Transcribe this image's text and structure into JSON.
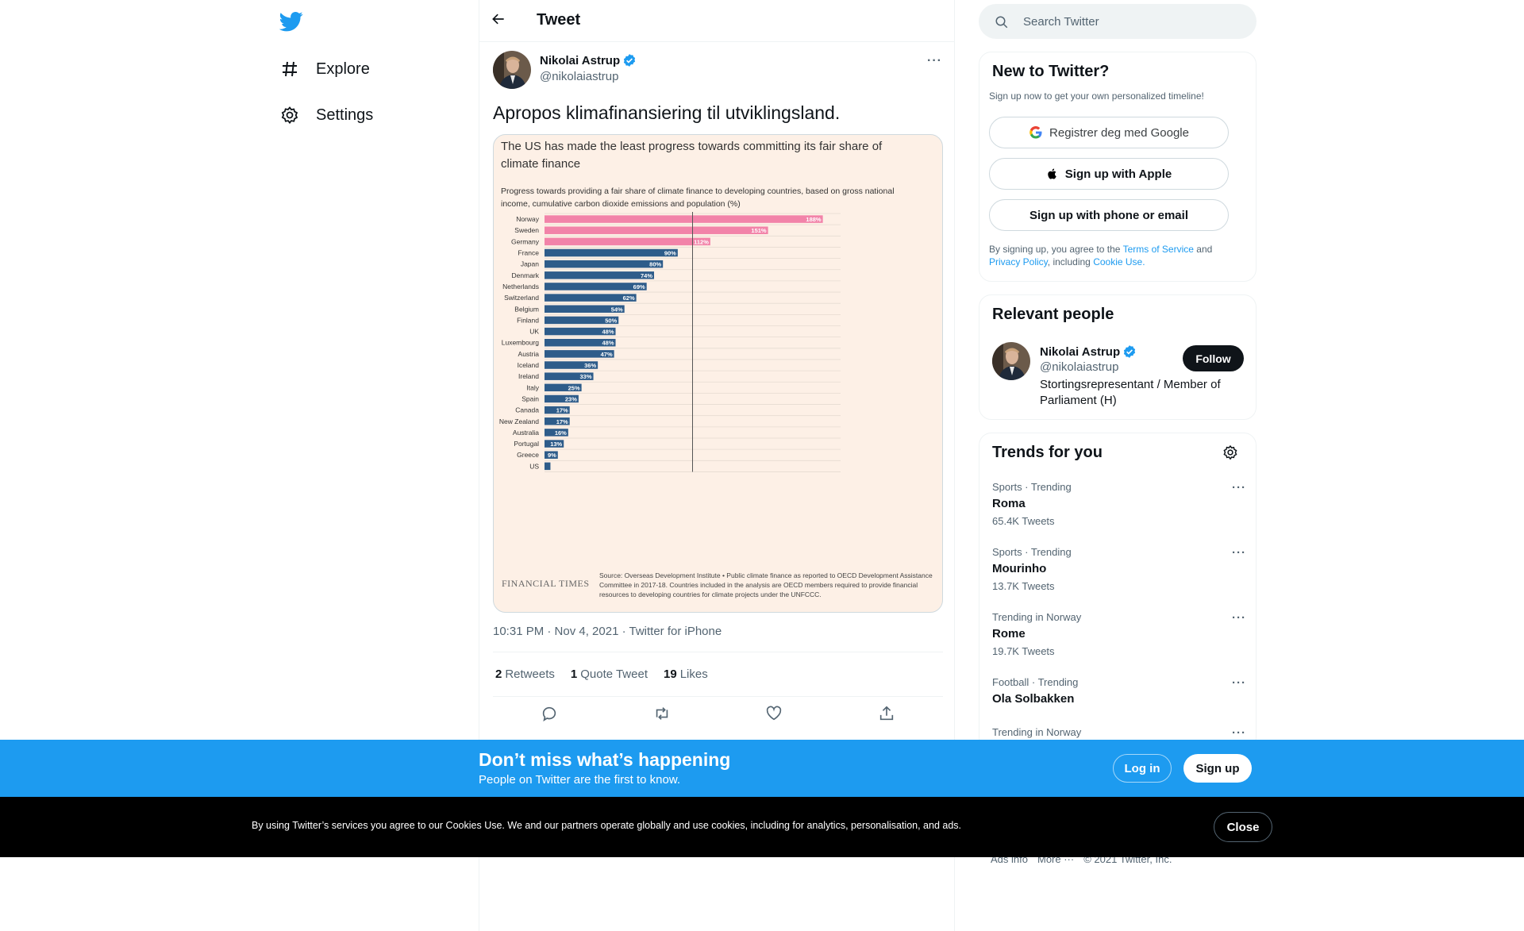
{
  "nav": {
    "items": [
      {
        "label": "Explore",
        "icon": "hashtag-icon"
      },
      {
        "label": "Settings",
        "icon": "gear-icon"
      }
    ]
  },
  "header": {
    "title": "Tweet"
  },
  "tweet": {
    "author_name": "Nikolai Astrup",
    "author_handle": "@nikolaiastrup",
    "text": "Apropos klimafinansiering til utviklingsland.",
    "meta": "10:31 PM · Nov 4, 2021 · Twitter for iPhone",
    "stats": [
      {
        "count": "2",
        "label": "Retweets"
      },
      {
        "count": "1",
        "label": "Quote Tweet"
      },
      {
        "count": "19",
        "label": "Likes"
      }
    ]
  },
  "media": {
    "title": "The US has made the least progress towards committing its fair share of climate finance",
    "subtitle": "Progress towards providing a fair share of climate finance to developing countries, based on gross national income, cumulative carbon dioxide emissions and population (%)",
    "brand": "FINANCIAL TIMES",
    "source": "Source: Overseas Development Institute • Public climate finance as reported to OECD Development Assistance Committee in 2017-18. Countries included in the analysis are OECD members required to provide financial resources to developing countries for climate projects under the UNFCCC."
  },
  "chart_data": {
    "type": "bar",
    "orientation": "horizontal",
    "title": "The US has made the least progress towards committing its fair share of climate finance",
    "subtitle": "Progress towards providing a fair share of climate finance to developing countries, based on gross national income, cumulative carbon dioxide emissions and population (%)",
    "categories": [
      "Norway",
      "Sweden",
      "Germany",
      "France",
      "Japan",
      "Denmark",
      "Netherlands",
      "Switzerland",
      "Belgium",
      "Finland",
      "UK",
      "Luxembourg",
      "Austria",
      "Iceland",
      "Ireland",
      "Italy",
      "Spain",
      "Canada",
      "New Zealand",
      "Australia",
      "Portugal",
      "Greece",
      "US"
    ],
    "values": [
      188,
      151,
      112,
      90,
      80,
      74,
      69,
      62,
      54,
      50,
      48,
      48,
      47,
      36,
      33,
      25,
      23,
      17,
      17,
      16,
      13,
      9,
      4
    ],
    "labels": [
      "188%",
      "151%",
      "112%",
      "90%",
      "80%",
      "74%",
      "69%",
      "62%",
      "54%",
      "50%",
      "48%",
      "48%",
      "47%",
      "36%",
      "33%",
      "25%",
      "23%",
      "17%",
      "17%",
      "16%",
      "13%",
      "9%",
      ""
    ],
    "reference_line": 100,
    "xlim": [
      0,
      200
    ],
    "colors": {
      "above_100": "#f283a9",
      "below_100": "#2e5c8a",
      "background": "#fdf0e6"
    },
    "grid": true
  },
  "right": {
    "search_placeholder": "Search Twitter",
    "signup_card": {
      "title": "New to Twitter?",
      "subtitle": "Sign up now to get your own personalized timeline!",
      "google": "Registrer deg med Google",
      "apple": "Sign up with Apple",
      "phone": "Sign up with phone or email",
      "legal_1": "By signing up, you agree to the",
      "terms": "Terms of Service",
      "and": "and",
      "privacy": "Privacy Policy",
      "including": ", including",
      "cookie": "Cookie Use."
    },
    "relevant": {
      "title": "Relevant people",
      "name": "Nikolai Astrup",
      "handle": "@nikolaiastrup",
      "bio": "Stortingsrepresentant / Member of Parliament (H)",
      "follow": "Follow"
    },
    "trends": {
      "title": "Trends for you",
      "items": [
        {
          "context": "Sports · Trending",
          "name": "Roma",
          "count": "65.4K Tweets"
        },
        {
          "context": "Sports · Trending",
          "name": "Mourinho",
          "count": "13.7K Tweets"
        },
        {
          "context": "Trending in Norway",
          "name": "Rome",
          "count": "19.7K Tweets"
        },
        {
          "context": "Football · Trending",
          "name": "Ola Solbakken",
          "count": ""
        },
        {
          "context": "Trending in Norway",
          "name": "",
          "count": ""
        }
      ]
    },
    "footer": [
      "Ads info",
      "More ···",
      "© 2021 Twitter, Inc."
    ]
  },
  "signup_bar": {
    "title": "Don’t miss what’s happening",
    "subtitle": "People on Twitter are the first to know.",
    "login": "Log in",
    "signup": "Sign up"
  },
  "cookie_bar": {
    "text": "By using Twitter’s services you agree to our Cookies Use. We and our partners operate globally and use cookies, including for analytics, personalisation, and ads.",
    "close": "Close"
  },
  "colors": {
    "accent": "#1d9bf0",
    "text": "#0f1419",
    "muted": "#536471",
    "verified": "#1d9bf0"
  }
}
